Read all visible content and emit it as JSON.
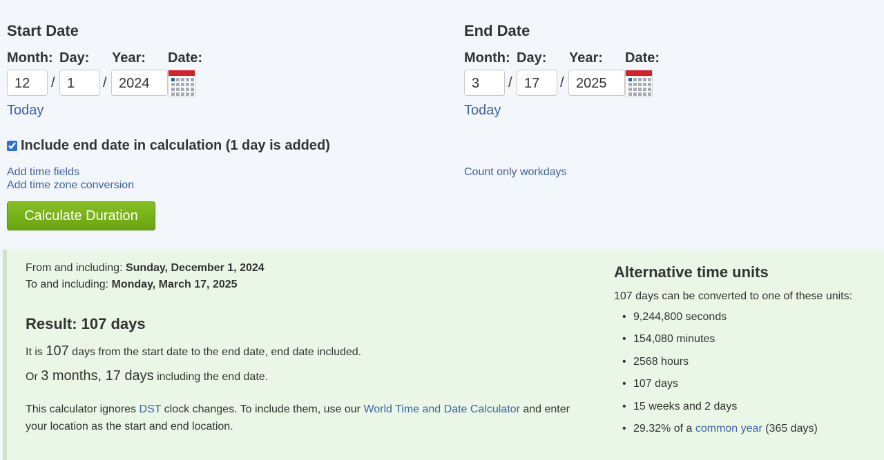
{
  "start": {
    "title": "Start Date",
    "month_label": "Month:",
    "day_label": "Day:",
    "year_label": "Year:",
    "date_label": "Date:",
    "month": "12",
    "day": "1",
    "year": "2024",
    "sep": "/",
    "today": "Today"
  },
  "end": {
    "title": "End Date",
    "month_label": "Month:",
    "day_label": "Day:",
    "year_label": "Year:",
    "date_label": "Date:",
    "month": "3",
    "day": "17",
    "year": "2025",
    "sep": "/",
    "today": "Today"
  },
  "include_end": {
    "checked": true,
    "label": "Include end date in calculation (1 day is added)"
  },
  "links": {
    "add_time_fields": "Add time fields",
    "add_time_zone": "Add time zone conversion",
    "count_workdays": "Count only workdays"
  },
  "calculate_button": "Calculate Duration",
  "result": {
    "from_prefix": "From and including: ",
    "from_date": "Sunday, December 1, 2024",
    "to_prefix": "To and including: ",
    "to_date": "Monday, March 17, 2025",
    "title": "Result: 107 days",
    "line1_prefix": "It is ",
    "line1_number": "107",
    "line1_suffix": " days from the start date to the end date, end date included.",
    "line2_prefix": "Or ",
    "line2_value": "3 months, 17 days",
    "line2_suffix": " including the end date.",
    "dst_1": "This calculator ignores ",
    "dst_link": "DST",
    "dst_2": " clock changes. To include them, use our ",
    "dst_link2": "World Time and Date Calculator",
    "dst_3": " and enter",
    "dst_4": "your location as the start and end location."
  },
  "alt_units": {
    "title": "Alternative time units",
    "intro": "107 days can be converted to one of these units:",
    "items": [
      "9,244,800 seconds",
      "154,080 minutes",
      "2568 hours",
      "107 days",
      "15 weeks and 2 days"
    ],
    "last_prefix": "29.32% of a ",
    "last_link": "common year",
    "last_suffix": " (365 days)"
  },
  "colors": {
    "link": "#3b62a8",
    "button": "#76b216",
    "result_bg": "#eaf7e6",
    "calendar_red": "#d6202a"
  }
}
